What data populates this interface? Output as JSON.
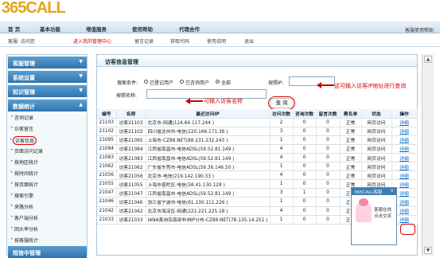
{
  "app": {
    "logo": "365CALL",
    "top_help": "客服使用帮助",
    "login": "客服: 访问您"
  },
  "nav": [
    "首 页",
    "基本功能",
    "增值服务",
    "使用帮助",
    "代理合作"
  ],
  "toolbar": [
    "进入我的管理中心",
    "留言记录",
    "获取代码",
    "使用说明",
    "退出"
  ],
  "sidebar": {
    "sections": [
      "客服管理",
      "系统设置",
      "知识管理",
      "数据统计",
      "短信中管理"
    ],
    "items": [
      "咨询记录",
      "访客留言",
      "访客信息",
      "页面访问记录",
      "按地区统计",
      "按时间统计",
      "按页面统计",
      "搜索引擎",
      "来路分析",
      "客户端分析",
      "回头率分析",
      "按客服统计"
    ]
  },
  "main": {
    "title": "访客信息管理",
    "search_condition": "搜索条件:",
    "radios": [
      "已登记用户",
      "已咨询用户",
      "全部"
    ],
    "ip_label": "按照IP:",
    "name_label": "按照名称:",
    "search_button": "查 询",
    "annotation_ip": "这可输入访客IP地址进行查询",
    "annotation_name": "可输入访客名称",
    "headers": [
      "编号",
      "名称",
      "最近访问IP",
      "访问次数",
      "咨询次数",
      "留言次数",
      "黑名单",
      "状态",
      "操作"
    ],
    "rows": [
      [
        "21103",
        "访客21103",
        "北京市-网通(124.64.117.244 )",
        "2",
        "0",
        "0",
        "正常",
        "网页访问",
        "详细"
      ],
      [
        "21102",
        "访客21102",
        "四川省达州市-电信(220.166.171.36 )",
        "3",
        "0",
        "0",
        "正常",
        "网页访问",
        "详细"
      ],
      [
        "21095",
        "访客21095",
        "上海市-CZ88.NET(88.231.232.243 )",
        "1",
        "0",
        "0",
        "正常",
        "网页访问",
        "详细"
      ],
      [
        "21084",
        "访客21084",
        "江西省南昌市-电信ADSL(59.52.81.149 )",
        "4",
        "0",
        "0",
        "正常",
        "网页访问",
        "详细"
      ],
      [
        "21083",
        "访客21083",
        "江西省南昌市-电信ADSL(59.52.81.149 )",
        "4",
        "0",
        "0",
        "正常",
        "网页访问",
        "详细"
      ],
      [
        "21062",
        "访客21062",
        "广东省东莞市-电信ADSL(59.36.146.50 )",
        "1",
        "0",
        "0",
        "正常",
        "网页访问",
        "详细"
      ],
      [
        "21056",
        "访客21056",
        "北京市-电信(219.142.190.33 )",
        "4",
        "0",
        "0",
        "正常",
        "网页访问",
        "详细"
      ],
      [
        "21055",
        "访客21055",
        "上海市普陀区-电信(58.41.130.128 )",
        "1",
        "0",
        "0",
        "正常",
        "网页访问",
        "详细"
      ],
      [
        "21047",
        "访客21047",
        "江西省南昌市-电信ADSL(59.52.81.149 )",
        "3",
        "1",
        "0",
        "正常",
        "网页访问",
        "详细"
      ],
      [
        "21046",
        "访客21046",
        "浙江省宁波市-电信(61.130.111.226 )",
        "1",
        "0",
        "0",
        "正常",
        "网页访问",
        "详细"
      ],
      [
        "21042",
        "访客21042",
        "北京市海淀区-网通(221.221.225.18 )",
        "4",
        "0",
        "0",
        "正常",
        "网页访问",
        "详细"
      ],
      [
        "21033",
        "访客21033",
        "IANA美洲及南部非洲IP分布-CZ88.NET(78.135.14.251 )",
        "1",
        "0",
        "0",
        "正常",
        "网页访问",
        "详细"
      ]
    ]
  },
  "widget": {
    "title": "365CALL客服",
    "line1": "客服在线",
    "line2": "点击交流"
  }
}
